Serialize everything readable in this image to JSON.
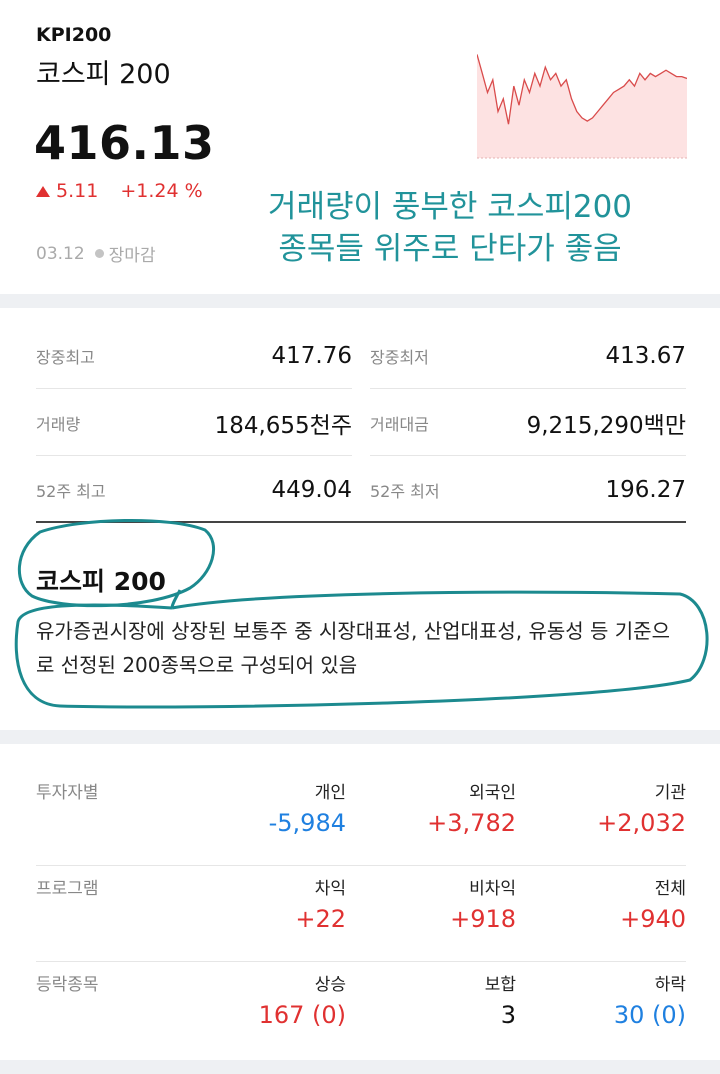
{
  "header": {
    "code": "KPI200",
    "name": "코스피 200",
    "price": "416.13",
    "change": "5.11",
    "change_pct": "+1.24 %",
    "date": "03.12",
    "status": "장마감"
  },
  "annotation": {
    "line1": "거래량이 풍부한 코스피200",
    "line2": "종목들 위주로 단타가 좋음"
  },
  "stats": [
    {
      "left_label": "장중최고",
      "left_value": "417.76",
      "right_label": "장중최저",
      "right_value": "413.67"
    },
    {
      "left_label": "거래량",
      "left_value": "184,655천주",
      "right_label": "거래대금",
      "right_value": "9,215,290백만"
    },
    {
      "left_label": "52주 최고",
      "left_value": "449.04",
      "right_label": "52주 최저",
      "right_value": "196.27"
    }
  ],
  "description": {
    "title": "코스피 200",
    "text": "유가증권시장에 상장된 보통주 중 시장대표성, 산업대표성, 유동성 등 기준으로 선정된 200종목으로 구성되어 있음"
  },
  "investors": [
    {
      "label": "투자자별",
      "cols": [
        {
          "h": "개인",
          "v": "-5,984",
          "color": "blue"
        },
        {
          "h": "외국인",
          "v": "+3,782",
          "color": "red"
        },
        {
          "h": "기관",
          "v": "+2,032",
          "color": "red"
        }
      ]
    },
    {
      "label": "프로그램",
      "cols": [
        {
          "h": "차익",
          "v": "+22",
          "color": "red"
        },
        {
          "h": "비차익",
          "v": "+918",
          "color": "red"
        },
        {
          "h": "전체",
          "v": "+940",
          "color": "red"
        }
      ]
    },
    {
      "label": "등락종목",
      "cols": [
        {
          "h": "상승",
          "v": "167 (0)",
          "color": "red"
        },
        {
          "h": "보합",
          "v": "3",
          "color": "black"
        },
        {
          "h": "하락",
          "v": "30 (0)",
          "color": "blue"
        }
      ]
    }
  ],
  "colors": {
    "up": "#e03131",
    "down": "#1f80e0",
    "annotation": "#21939a"
  },
  "mini_chart": {
    "series": [
      420,
      417,
      414,
      416,
      411,
      413,
      409,
      415,
      412,
      416,
      414,
      417,
      415,
      418,
      416,
      417,
      415,
      416,
      413,
      411,
      410,
      409.5,
      410,
      411,
      412,
      413,
      414,
      414.5,
      415,
      416,
      415,
      417,
      416,
      417,
      416.5,
      417,
      417.5,
      417,
      416.5,
      416.5,
      416.2
    ]
  }
}
